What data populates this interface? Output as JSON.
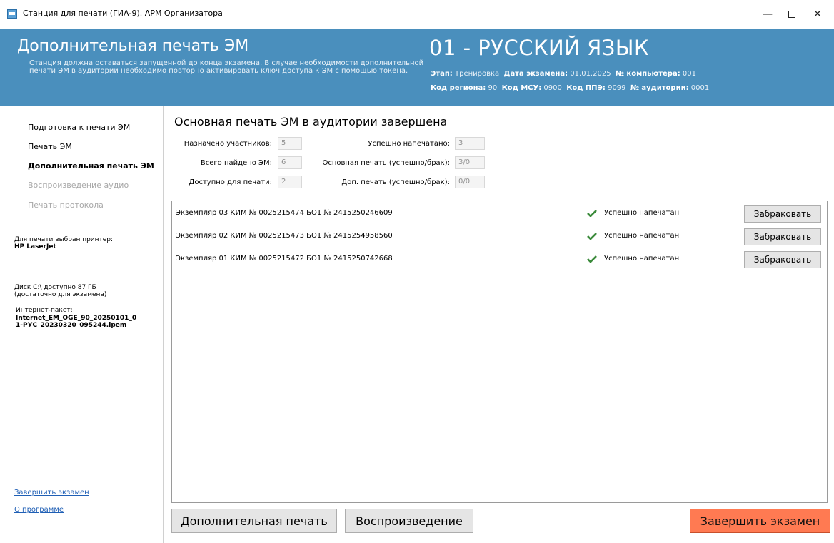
{
  "window": {
    "title": "Станция для печати (ГИА-9). АРМ Организатора",
    "minimize": "—",
    "close": "✕"
  },
  "header": {
    "title": "Дополнительная печать ЭМ",
    "description": "Станция должна оставаться запущенной до конца экзамена. В случае необходимости дополнительной печати ЭМ в аудитории необходимо повторно активировать ключ доступа к ЭМ с помощью токена.",
    "subject": "01 - РУССКИЙ ЯЗЫК",
    "stage_label": "Этап:",
    "stage_value": "Тренировка",
    "date_label": "Дата экзамена:",
    "date_value": "01.01.2025",
    "computer_label": "№ компьютера:",
    "computer_value": "001",
    "region_label": "Код региона:",
    "region_value": "90",
    "msu_label": "Код МСУ:",
    "msu_value": "0900",
    "ppe_label": "Код ППЭ:",
    "ppe_value": "9099",
    "auditorium_label": "№ аудитории:",
    "auditorium_value": "0001"
  },
  "sidebar": {
    "items": [
      {
        "label": "Подготовка к печати ЭМ",
        "state": "normal"
      },
      {
        "label": "Печать ЭМ",
        "state": "normal"
      },
      {
        "label": "Дополнительная печать ЭМ",
        "state": "active"
      },
      {
        "label": "Воспроизведение аудио",
        "state": "disabled"
      },
      {
        "label": "Печать протокола",
        "state": "disabled"
      }
    ],
    "printer_label": "Для печати выбран принтер:",
    "printer_name": "HP LaserJet",
    "disk_line1": "Диск C:\\ доступно 87 ГБ",
    "disk_line2": "(достаточно для экзамена)",
    "package_label": "Интернет-пакет:",
    "package_line1": "Internet_EM_OGE_90_20250101_0",
    "package_line2": "1-РУС_20230320_095244.ipem",
    "finish_link": "Завершить экзамен",
    "about_link": "О программе"
  },
  "main": {
    "title": "Основная печать ЭМ в аудитории завершена",
    "stats": {
      "assigned_label": "Назначено участников:",
      "assigned_value": "5",
      "found_label": "Всего найдено ЭМ:",
      "found_value": "6",
      "available_label": "Доступно для печати:",
      "available_value": "2",
      "printed_label": "Успешно напечатано:",
      "printed_value": "3",
      "main_print_label": "Основная печать (успешно/брак):",
      "main_print_value": "3/0",
      "extra_print_label": "Доп. печать (успешно/брак):",
      "extra_print_value": "0/0"
    },
    "rows": [
      {
        "info": "Экземпляр 03  КИМ № 0025215474  БО1 № 2415250246609",
        "status": "Успешно напечатан",
        "button": "Забраковать"
      },
      {
        "info": "Экземпляр 02  КИМ № 0025215473  БО1 № 2415254958560",
        "status": "Успешно напечатан",
        "button": "Забраковать"
      },
      {
        "info": "Экземпляр 01  КИМ № 0025215472  БО1 № 2415250742668",
        "status": "Успешно напечатан",
        "button": "Забраковать"
      }
    ],
    "buttons": {
      "extra_print": "Дополнительная печать",
      "playback": "Воспроизведение",
      "finish": "Завершить экзамен"
    }
  },
  "colors": {
    "header_bg": "#4a8fbd",
    "finish_button": "#ff7a52",
    "check": "#3a8a3a",
    "link": "#1f5fb5"
  }
}
